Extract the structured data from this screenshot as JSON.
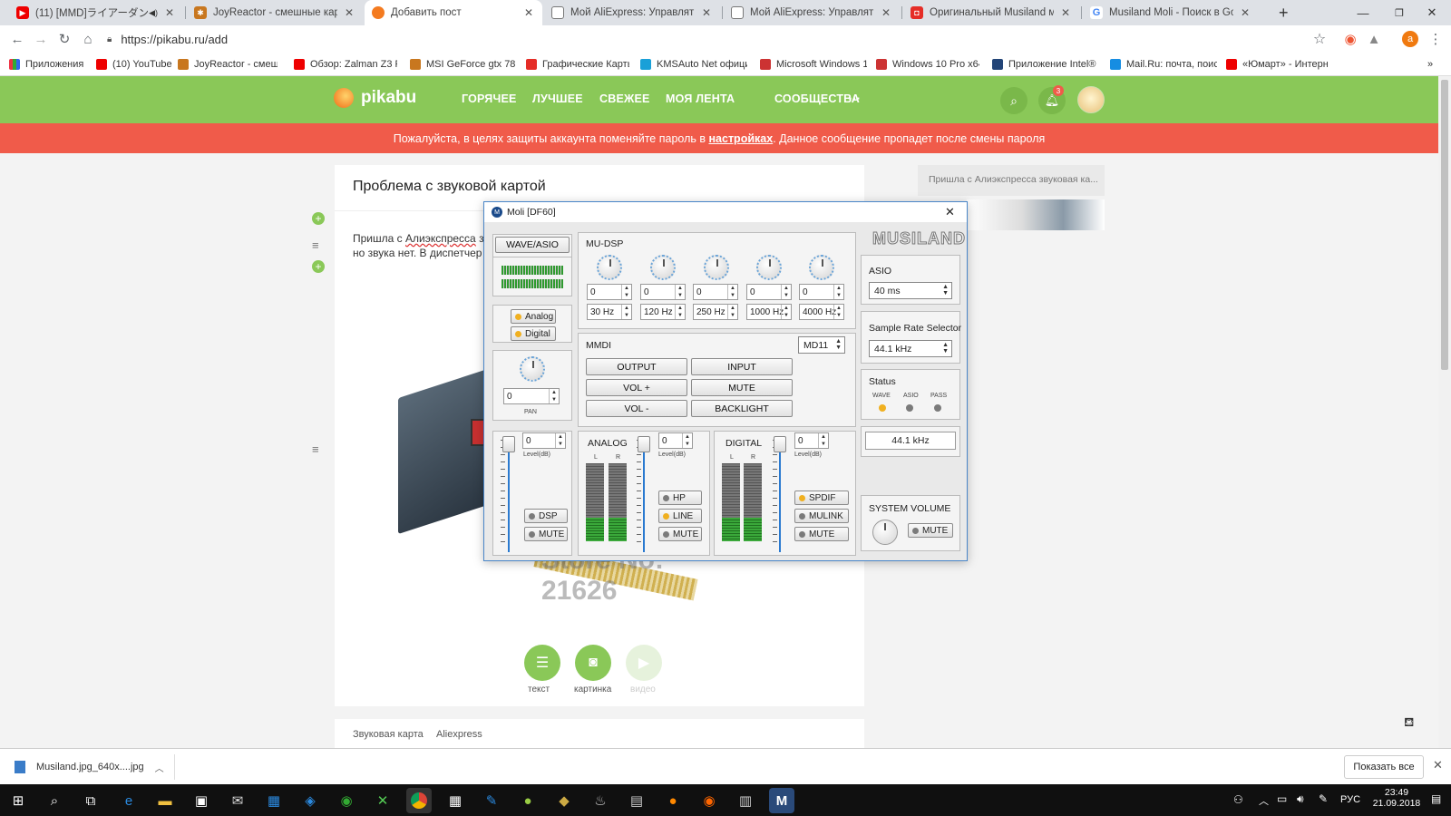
{
  "browser": {
    "tabs": [
      {
        "title": "(11) [MMD]ライアーダンス/Liar",
        "color": "#e00"
      },
      {
        "title": "JoyReactor - смешные картинки",
        "color": "#c8771f"
      },
      {
        "title": "Добавить пост",
        "color": "#f47b20"
      },
      {
        "title": "Мой AliExpress: Управлять заказ",
        "color": "#666"
      },
      {
        "title": "Мой AliExpress: Управлять заказ",
        "color": "#666"
      },
      {
        "title": "Оригинальный Musiland моли",
        "color": "#e52d27"
      },
      {
        "title": "Musiland Moli - Поиск в Google",
        "color": "#4285f4"
      }
    ],
    "url": "https://pikabu.ru/add",
    "profile_initial": "a",
    "bookmarks": [
      {
        "label": "Приложения",
        "color": "#e34"
      },
      {
        "label": "(10) YouTube",
        "color": "#e00"
      },
      {
        "label": "JoyReactor - смешн",
        "color": "#c8771f"
      },
      {
        "label": "Обзор: Zalman Z3 Pl",
        "color": "#e00"
      },
      {
        "label": "MSI GeForce gtx 780",
        "color": "#c8771f"
      },
      {
        "label": "Графические Карты",
        "color": "#e52d27"
      },
      {
        "label": "KMSAuto Net офици",
        "color": "#1aa0d8"
      },
      {
        "label": "Microsoft Windows 1",
        "color": "#c33"
      },
      {
        "label": "Windows 10 Pro x64",
        "color": "#c33"
      },
      {
        "label": "Приложение Intel®",
        "color": "#247"
      },
      {
        "label": "Mail.Ru: почта, поис",
        "color": "#168de2"
      },
      {
        "label": "«Юмарт» - Интерн",
        "color": "#e00"
      }
    ]
  },
  "site": {
    "logo": "pikabu",
    "nav": [
      "ГОРЯЧЕЕ",
      "ЛУЧШЕЕ",
      "СВЕЖЕЕ",
      "МОЯ ЛЕНТА",
      "СООБЩЕСТВА",
      "···"
    ],
    "notification_count": "3",
    "notice_before": "Пожалуйста, в целях защиты аккаунта поменяйте пароль в ",
    "notice_link": "настройках",
    "notice_after": ". Данное сообщение пропадет после смены пароля",
    "post_title": "Проблема с звуковой картой",
    "post_text_1": "Пришла с ",
    "post_text_link": "Алиэкспресса",
    "post_text_2": " з",
    "post_text_line2": "но звука нет. В диспетчер",
    "watermark": "Store No: 21626",
    "add_buttons": [
      {
        "label": "текст",
        "active": true
      },
      {
        "label": "картинка",
        "active": true
      },
      {
        "label": "видео",
        "active": false
      }
    ],
    "tags": [
      "Звуковая карта",
      "Aliexpress"
    ],
    "sidebar_preview": "Пришла с Алиэкспресса звуковая ка..."
  },
  "musiland": {
    "title": "Moli [DF60]",
    "brand": "MUSILAND",
    "wave_asio": "WAVE/ASIO",
    "analog_btn": "Analog",
    "digital_btn": "Digital",
    "pan_value": "0",
    "pan_label": "PAN",
    "mudsp_label": "MU-DSP",
    "eq_gains": [
      "0",
      "0",
      "0",
      "0",
      "0"
    ],
    "eq_freqs": [
      "30 Hz",
      "120 Hz",
      "250 Hz",
      "1000 Hz",
      "4000 Hz"
    ],
    "mmdi_label": "MMDI",
    "mmdi_select": "MD11",
    "mmdi_buttons": [
      "OUTPUT",
      "INPUT",
      "VOL +",
      "MUTE",
      "VOL -",
      "BACKLIGHT"
    ],
    "level_label": "Level(dB)",
    "main_level": "0",
    "dsp_btn": "DSP",
    "mute_btn": "MUTE",
    "analog_label": "ANALOG",
    "analog_level": "0",
    "hp_btn": "HP",
    "line_btn": "LINE",
    "digital_label": "DIGITAL",
    "digital_level": "0",
    "spdif_btn": "SPDIF",
    "mulink_btn": "MULINK",
    "lr": [
      "L",
      "R"
    ],
    "asio_label": "ASIO",
    "asio_value": "40 ms",
    "srs_label": "Sample Rate Selector",
    "srs_value": "44.1 kHz",
    "status_label": "Status",
    "status_items": [
      "WAVE",
      "ASIO",
      "PASS"
    ],
    "rate_display": "44.1 kHz",
    "sysvol_label": "SYSTEM VOLUME",
    "sysvol_mute": "MUTE",
    "colors": {
      "led_on": "#f0b020",
      "led_off": "#7a7a7a",
      "slider": "#2a7ad0"
    }
  },
  "downloads": {
    "file": "Musiland.jpg_640x....jpg",
    "show_all": "Показать все"
  },
  "taskbar": {
    "lang": "РУС",
    "time": "23:49",
    "date": "21.09.2018"
  },
  "colors": {
    "pikabu_green": "#8ac858",
    "notice_red": "#f05b4a"
  }
}
